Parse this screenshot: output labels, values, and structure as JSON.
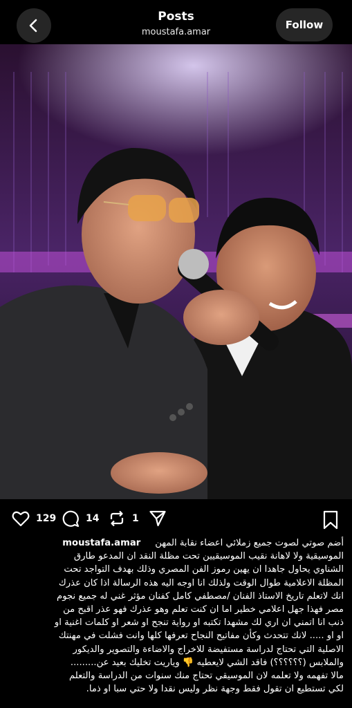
{
  "header": {
    "title": "Posts",
    "subtitle": "moustafa.amar",
    "follow_label": "Follow"
  },
  "actions": {
    "likes": "129",
    "comments": "14",
    "reposts": "1"
  },
  "caption": {
    "username": "moustafa.amar",
    "line1": "أضم صوتي لصوت جميع زملائي اعضاء نقابة المهن",
    "lines": [
      "الموسيقية ولا لاهانة نقيب الموسيقيين تحت مظلة النقد ان المدعو طارق",
      "الشناوي يحاول جاهدا ان يهين رموز الفن المصري وذلك بهدف التواجد تحت",
      "المظلة الاعلامية طوال الوقت ولذلك انا اوجه اليه هذه الرسالة اذا كان عذرك",
      "انك لاتعلم تاريخ الاستاذ الفنان /مصطفي كامل كفنان مؤثر غني له جميع نجوم",
      "مصر فهذا جهل اعلامي خطير اما ان كنت تعلم وهو عذرك فهو عذر اقبح من",
      "ذنب انا اتمني ان اري لك مشهدا تكتبه او رواية تنجح او شعر او كلمات اغنية او",
      "او او ..... لانك تتحدث وكأن مفاتيح النجاح تعرفها كلها وانت فشلت في مهنتك",
      "الاصلية التي تحتاج لدراسة مستفيضة للاخراج والاضاءة والتصوير والديكور",
      "والملابس (؟؟؟؟؟؟) فاقد الشي لايعطيه 👎 وياريت تخليك بعيد عن.........",
      "مالا تفهمه ولا تعلمه لان الموسيقي تحتاج منك سنوات من الدراسة والتعلم",
      "لكي تستطيع ان تقول فقط وجهة نظر وليس نقدا ولا حتي سبا او ذما."
    ]
  },
  "colors": {
    "background": "#000000",
    "button_bg": "#262626",
    "stage_purple": "#7a3a9e",
    "text": "#ffffff"
  },
  "icons": [
    "back-arrow-icon",
    "heart-icon",
    "comment-icon",
    "repost-icon",
    "share-icon",
    "bookmark-icon"
  ]
}
